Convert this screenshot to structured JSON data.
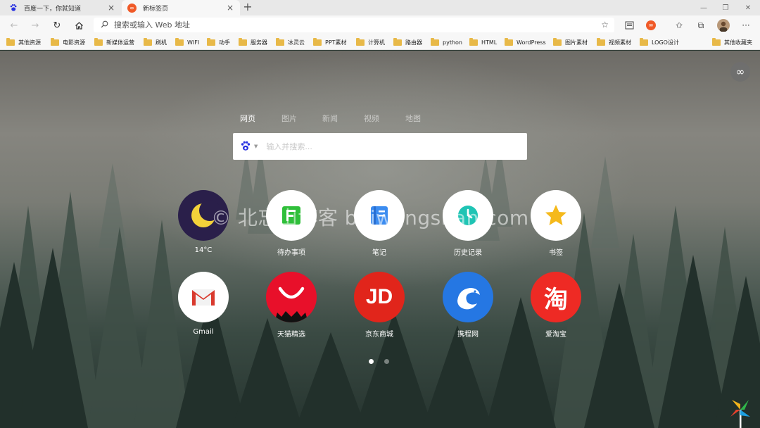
{
  "browser": {
    "tabs": [
      {
        "title": "百度一下，你就知道",
        "active": false,
        "icon": "baidu-paw-icon"
      },
      {
        "title": "新标签页",
        "active": true,
        "icon": "infinity-icon"
      }
    ],
    "new_tab_symbol": "+",
    "address_placeholder": "搜索或输入 Web 地址"
  },
  "bookmarks": {
    "items": [
      "其他资源",
      "电影资源",
      "新媒体运营",
      "刷机",
      "WIFI",
      "动手",
      "服务器",
      "冰灵云",
      "PPT素材",
      "计算机",
      "路由器",
      "python",
      "HTML",
      "WordPress",
      "图片素材",
      "视频素材",
      "LOGO设计"
    ],
    "other": "其他收藏夹"
  },
  "newtab": {
    "search_tabs": [
      "网页",
      "图片",
      "新闻",
      "视频",
      "地图"
    ],
    "active_search_tab": 0,
    "search_placeholder": "输入并搜索...",
    "tiles": [
      {
        "label": "14°C",
        "icon": "moon-weather-icon",
        "bg": "#2a1f4a"
      },
      {
        "label": "待办事项",
        "icon": "todo-icon",
        "bg": "#ffffff"
      },
      {
        "label": "笔记",
        "icon": "notes-icon",
        "bg": "#ffffff"
      },
      {
        "label": "历史记录",
        "icon": "history-icon",
        "bg": "#ffffff"
      },
      {
        "label": "书签",
        "icon": "star-icon",
        "bg": "#ffffff"
      },
      {
        "label": "Gmail",
        "icon": "gmail-icon",
        "bg": "#ffffff"
      },
      {
        "label": "天猫精选",
        "icon": "tmall-icon",
        "bg": "#e8102a"
      },
      {
        "label": "京东商城",
        "icon": "jd-icon",
        "bg": "#e1251b"
      },
      {
        "label": "携程网",
        "icon": "ctrip-icon",
        "bg": "#2577e3"
      },
      {
        "label": "爱淘宝",
        "icon": "taobao-icon",
        "bg": "#ee2a24"
      }
    ],
    "jd_text": "JD",
    "taobao_text": "淘",
    "page_dots": 2,
    "active_dot": 0
  },
  "watermark": "© 北忘山博客 beiwangshan.com",
  "colors": {
    "accent_blue": "#2577e3",
    "folder_yellow": "#e8b948",
    "baidu_blue": "#2932e1"
  }
}
